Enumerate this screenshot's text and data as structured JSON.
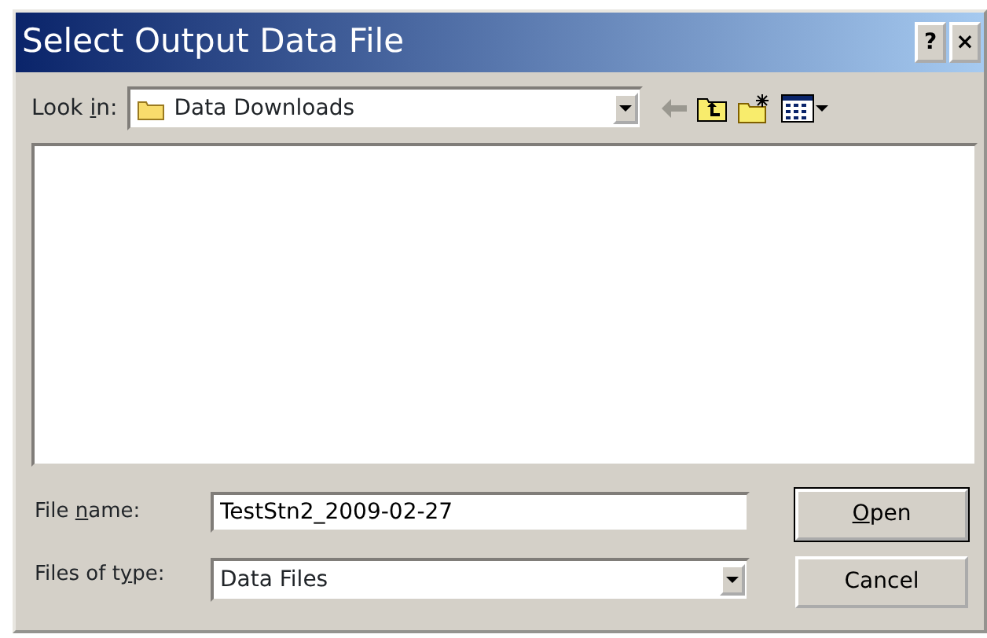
{
  "window": {
    "title": "Select Output Data File",
    "title_buttons": [
      "?",
      "×"
    ]
  },
  "look_in": {
    "label": {
      "before": "Look ",
      "key": "i",
      "after": "n:"
    },
    "value": "Data Downloads"
  },
  "file_name": {
    "label": {
      "before": "File ",
      "key": "n",
      "after": "ame:"
    },
    "value": "TestStn2_2009-02-27"
  },
  "file_type": {
    "label": {
      "before": "Files of t",
      "key": "y",
      "after": "pe:"
    },
    "value": "Data Files"
  },
  "buttons": [
    {
      "label": {
        "key": "O",
        "after": "pen"
      },
      "default": true
    },
    {
      "label": {
        "before": "Cancel"
      },
      "default": false
    }
  ]
}
